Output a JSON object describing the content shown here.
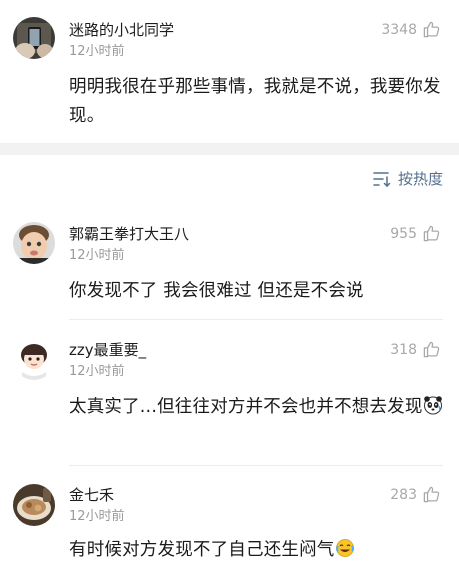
{
  "comments": [
    {
      "user": "迷路的小北同学",
      "time": "12小时前",
      "likes": "3348",
      "text": "明明我很在乎那些事情，我就是不说，我要你发现。",
      "avatar_icon": "avatar-photo-phone-icon"
    },
    {
      "user": "郭霸王拳打大王八",
      "time": "12小时前",
      "likes": "955",
      "text": "你发现不了 我会很难过 但还是不会说",
      "avatar_icon": "avatar-photo-child-icon"
    },
    {
      "user": "zzy最重要_",
      "time": "12小时前",
      "likes": "318",
      "text": "太真实了...但往往对方并不会也并不想去发现",
      "avatar_icon": "avatar-cartoon-girl-icon",
      "trailing_emoji": "panda-emoji-icon"
    },
    {
      "user": "金七禾",
      "time": "12小时前",
      "likes": "283",
      "text": "有时候对方发现不了自己还生闷气",
      "avatar_icon": "avatar-photo-food-icon",
      "trailing_emoji": "laugh-cry-emoji-icon"
    }
  ],
  "sort": {
    "label": "按热度",
    "icon": "sort-lines-icon"
  },
  "colors": {
    "name": "#1d1d1d",
    "meta": "#9a9a9a",
    "like": "#a8a8a8",
    "sort_accent": "#55708f",
    "band": "#f2f2f2"
  }
}
